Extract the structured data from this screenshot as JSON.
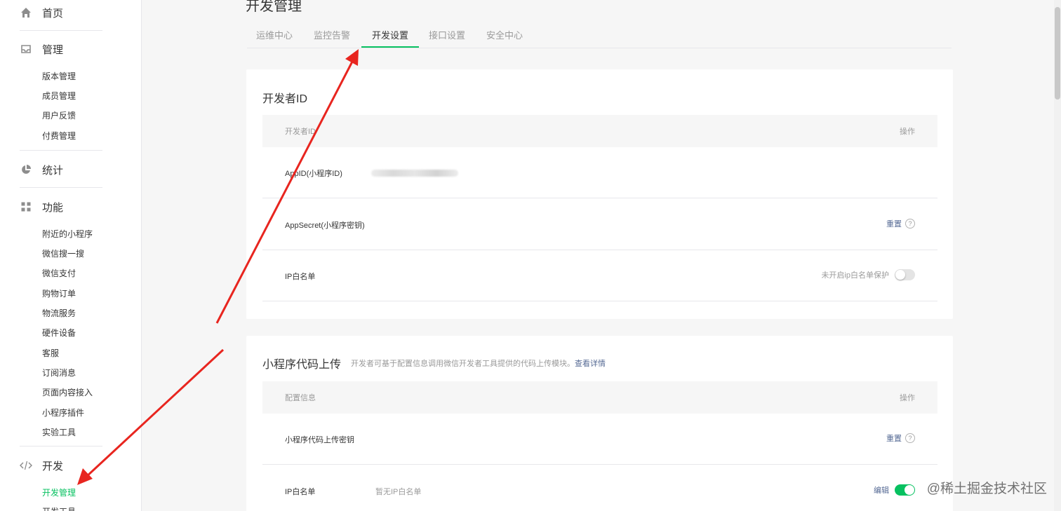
{
  "sidebar": {
    "groups": [
      {
        "label": "首页",
        "icon": "home-icon"
      },
      {
        "label": "管理",
        "icon": "inbox-icon",
        "items": [
          "版本管理",
          "成员管理",
          "用户反馈",
          "付费管理"
        ]
      },
      {
        "label": "统计",
        "icon": "pie-chart-icon"
      },
      {
        "label": "功能",
        "icon": "grid-icon",
        "items": [
          "附近的小程序",
          "微信搜一搜",
          "微信支付",
          "购物订单",
          "物流服务",
          "硬件设备",
          "客服",
          "订阅消息",
          "页面内容接入",
          "小程序插件",
          "实验工具"
        ]
      },
      {
        "label": "开发",
        "icon": "code-icon",
        "items": [
          "开发管理",
          "开发工具"
        ]
      }
    ]
  },
  "page": {
    "title": "开发管理",
    "tabs": [
      "运维中心",
      "监控告警",
      "开发设置",
      "接口设置",
      "安全中心"
    ],
    "active_tab": "开发设置"
  },
  "developer_id": {
    "title": "开发者ID",
    "header_name": "开发者ID",
    "header_action": "操作",
    "appid_label": "AppID(小程序ID)",
    "secret_label": "AppSecret(小程序密钥)",
    "secret_action": "重置",
    "ip_label": "IP白名单",
    "ip_status": "未开启ip白名单保护"
  },
  "code_upload": {
    "title": "小程序代码上传",
    "desc": "开发者可基于配置信息调用微信开发者工具提供的代码上传模块。",
    "desc_link": "查看详情",
    "header_name": "配置信息",
    "header_action": "操作",
    "key_label": "小程序代码上传密钥",
    "key_action": "重置",
    "ip_label": "IP白名单",
    "ip_value": "暂无IP白名单",
    "ip_action": "编辑"
  },
  "help_glyph": "?",
  "watermark": "@稀土掘金技术社区",
  "colors": {
    "accent": "#07c160",
    "link": "#576b95",
    "arrow": "#e8251f"
  }
}
